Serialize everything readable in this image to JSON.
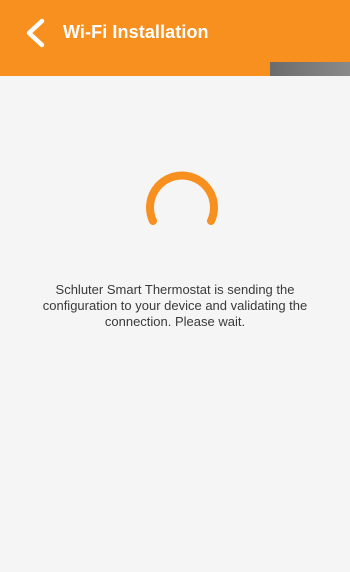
{
  "header": {
    "title": "Wi-Fi Installation",
    "back_icon": "chevron-left-icon",
    "background_color": "#f7901e"
  },
  "progress": {
    "fraction": 0.23,
    "track_color": "#f7901e",
    "fill_color": "#777777"
  },
  "loading": {
    "spinner_icon": "loading-spinner-icon",
    "spinner_color": "#f7901e",
    "message": "Schluter Smart Thermostat is sending the configuration to your device and validating the connection. Please wait."
  }
}
